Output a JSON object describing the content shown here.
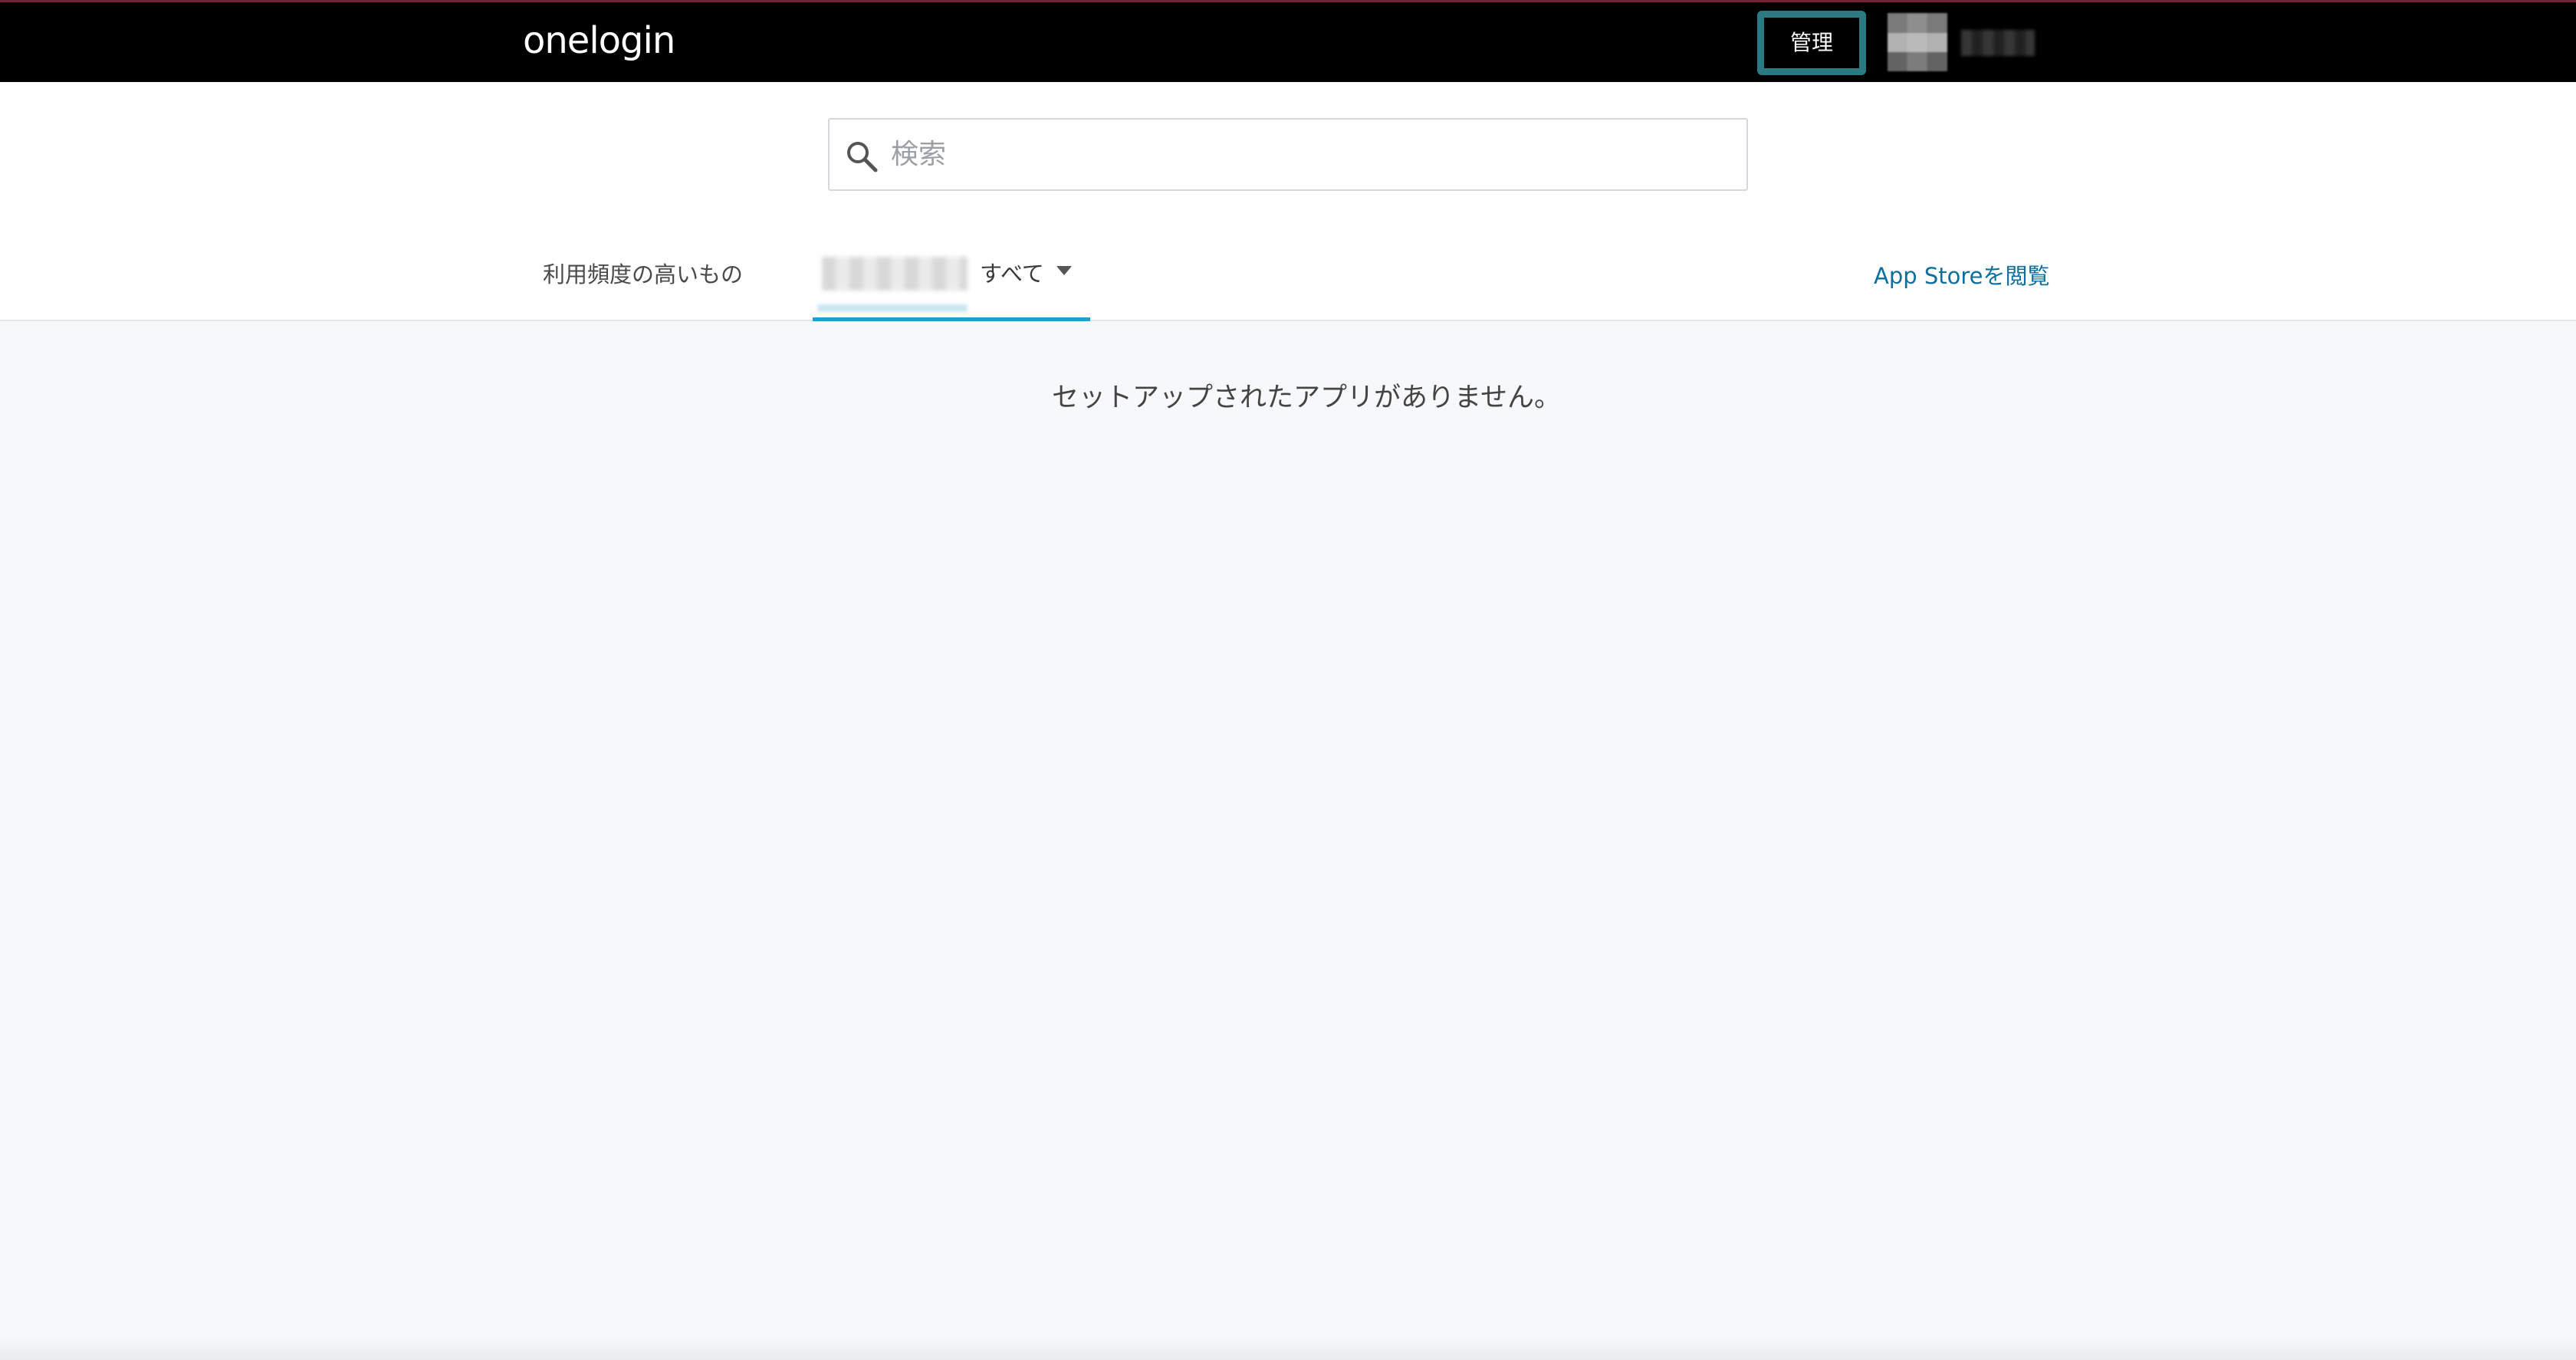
{
  "topbar": {
    "logo_text": "onelogin",
    "admin_label": "管理",
    "accent_color": "#2b7a82"
  },
  "search": {
    "placeholder": "検索",
    "value": ""
  },
  "tabs": {
    "frequent_label": "利用頻度の高いもの",
    "all_label": "すべて",
    "active_color": "#1f9fd3"
  },
  "appstore_link_label": "App Storeを閲覧",
  "main": {
    "empty_message": "セットアップされたアプリがありません。"
  }
}
